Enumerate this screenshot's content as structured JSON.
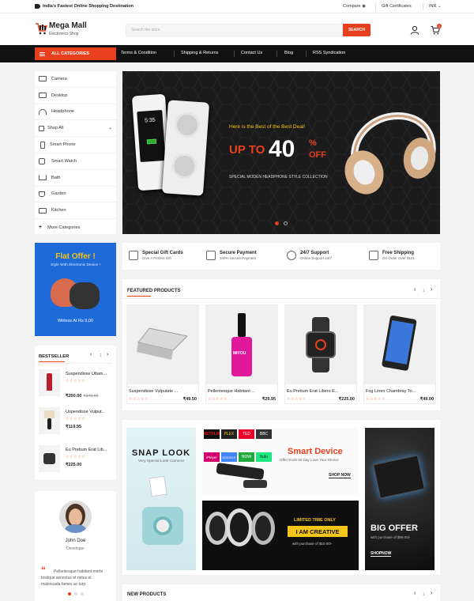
{
  "topbar": {
    "tagline": "India's Fastest Online Shopping Destination",
    "links": [
      "Compare ◉",
      "Gift Certificates",
      "INR ⌄"
    ]
  },
  "header": {
    "logo_title": "Mega Mall",
    "logo_subtitle": "Electronics Shop",
    "search_placeholder": "Search the store",
    "search_button": "SEARCH",
    "cart_count": "0"
  },
  "nav": {
    "categories_label": "ALL CATEGORIES",
    "links": [
      "Terms & Condition",
      "Shipping & Returns",
      "Contact Us",
      "Blog",
      "RSS Syndication"
    ]
  },
  "sidebar": {
    "items": [
      {
        "label": "Camera",
        "icon": "camera-icon"
      },
      {
        "label": "Desktop",
        "icon": "desktop-icon"
      },
      {
        "label": "Headphone",
        "icon": "headphone-icon"
      },
      {
        "label": "Shop All",
        "icon": "shop-icon"
      },
      {
        "label": "Smart Phone",
        "icon": "phone-icon"
      },
      {
        "label": "Smart Watch",
        "icon": "watch-icon"
      },
      {
        "label": "Bath",
        "icon": "bath-icon"
      },
      {
        "label": "Garden",
        "icon": "garden-icon"
      },
      {
        "label": "Kitchen",
        "icon": "kitchen-icon"
      }
    ],
    "more": "More Categories"
  },
  "hero": {
    "kicker": "Here is the Best of the Best Deal!",
    "up_to": "UP TO",
    "percent": "40",
    "pct_sign": "%",
    "off": "OFF",
    "subtitle": "SPECIAL MODEN HEADPHONE STYLE COLLECTION",
    "phone_time": "5:35"
  },
  "features": [
    {
      "title": "Special Gift Cards",
      "sub": "Give A Perfect Gift"
    },
    {
      "title": "Secure Payment",
      "sub": "100% Secure Payment"
    },
    {
      "title": "24/7 Support",
      "sub": "Online Support 24/7"
    },
    {
      "title": "Free Shipping",
      "sub": "On Order Over $101"
    }
  ],
  "flat_offer": {
    "title": "Flat Offer !",
    "sub": "Style With Electronic Device !",
    "price": "Wirless At Rs 9,00"
  },
  "bestseller": {
    "title": "BESTSELLER",
    "items": [
      {
        "name": "Suspendisse Ultam...",
        "price": "₹200.00",
        "old": "₹340.00"
      },
      {
        "name": "Uspendisse Vulput...",
        "price": "₹119.95",
        "old": ""
      },
      {
        "name": "Eu Pretium Erat Lib...",
        "price": "₹225.00",
        "old": ""
      }
    ]
  },
  "testimonial": {
    "name": "John Doe",
    "role": "Developer",
    "quote": "Pellentesque habitant morbi tristique senectus et netus et malesuada fames ac turp."
  },
  "featured": {
    "title": "FEATURED PRODUCTS",
    "page": "1",
    "products": [
      {
        "name": "Suspendisse Vulputate ...",
        "price": "₹49.50"
      },
      {
        "name": "Pellentesque Habitant ...",
        "price": "₹29.95"
      },
      {
        "name": "Eu Pretium Erat Libero E...",
        "price": "₹225.00"
      },
      {
        "name": "Fog Linen Chambray To...",
        "price": "₹49.00"
      }
    ],
    "nail_label": "MIYOU",
    "stars": "☆☆☆☆☆"
  },
  "banners": {
    "snap_look": "SNAP LOOK",
    "snap_sub": "Very Special Look Camera!",
    "smart_title": "Smart Device",
    "smart_sub": "Offer Ends 30 Day Love Your Device",
    "shop_now": "SHOP NOW",
    "streaming_logos": [
      "NETFLIX",
      "PLEX",
      "TED",
      "BBC",
      "iPlayer",
      "GOOGLE",
      "NOW",
      "hulu"
    ],
    "limited": "LIMITED TIME ONLY",
    "creative": "I AM CREATIVE",
    "creative_price": "with purchase of $10.00/-",
    "big_offer": "BIG OFFER",
    "big_price": "with purchase of $99.00/-",
    "shopnow2": "SHOPNOW"
  },
  "new_products": {
    "title": "NEW PRODUCTS",
    "page": "1"
  },
  "colors": {
    "accent": "#e8401c",
    "dark": "#111111",
    "blue": "#1e6ad8",
    "yellow": "#f5c518"
  }
}
